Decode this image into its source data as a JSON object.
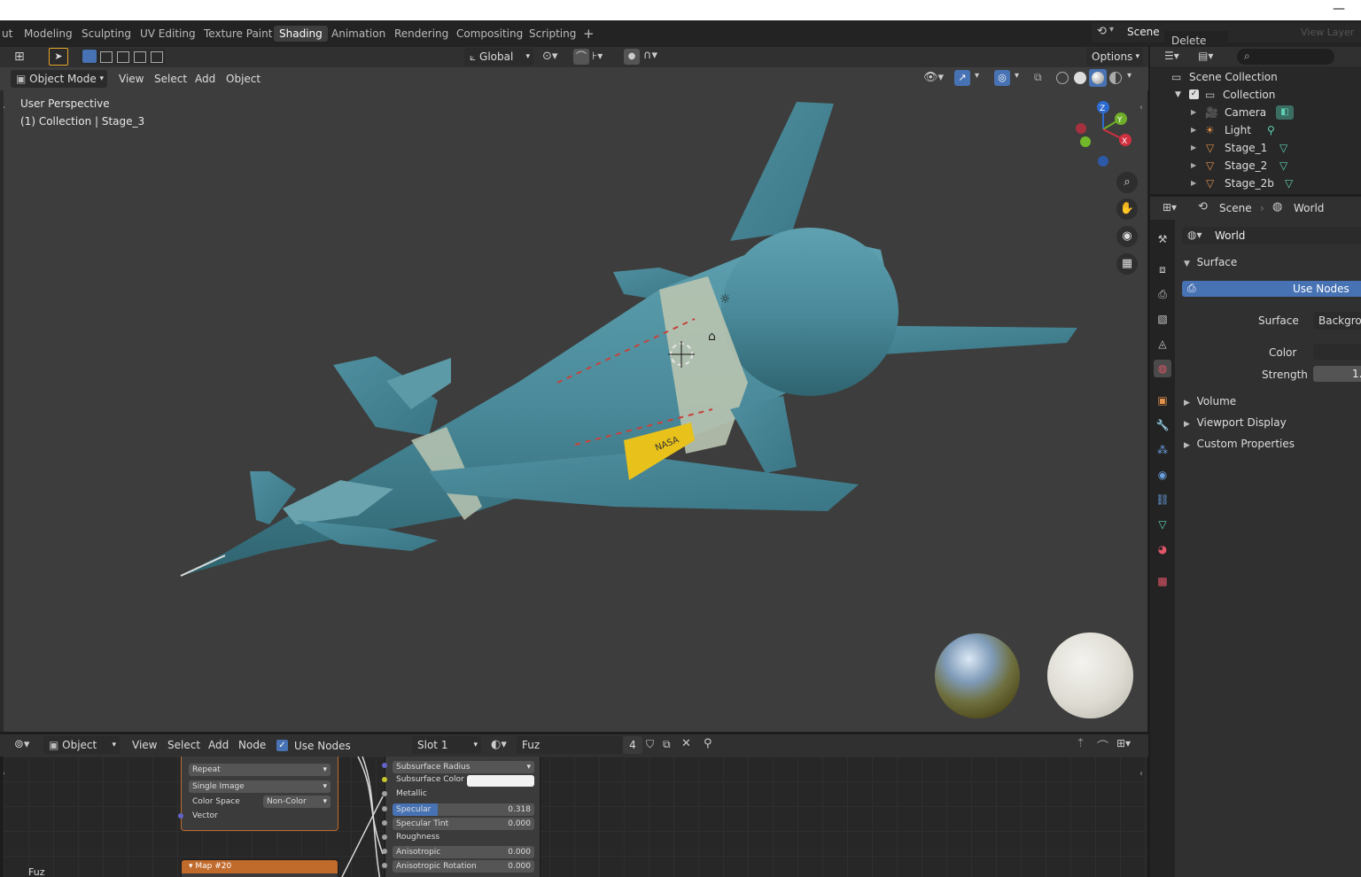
{
  "workspace_tabs": [
    "ut",
    "Modeling",
    "Sculpting",
    "UV Editing",
    "Texture Paint",
    "Shading",
    "Animation",
    "Rendering",
    "Compositing",
    "Scripting",
    "+"
  ],
  "active_tab": "Shading",
  "scene_selector": {
    "label": "Scene",
    "view_layer": "View Layer"
  },
  "delete_popup": "Delete",
  "viewport_header": {
    "transform_orientation": "Global",
    "options": "Options",
    "mode": "Object Mode",
    "menus": [
      "View",
      "Select",
      "Add",
      "Object"
    ]
  },
  "viewport": {
    "perspective": "User Perspective",
    "collection_info": "(1) Collection | Stage_3",
    "gizmo": {
      "z": "Z",
      "y": "Y",
      "x": "X"
    },
    "decal_text": "NASA"
  },
  "outliner": {
    "root": "Scene Collection",
    "collection": "Collection",
    "items": [
      "Camera",
      "Light",
      "Stage_1",
      "Stage_2",
      "Stage_2b"
    ]
  },
  "properties": {
    "scene_tab": "Scene",
    "world_tab": "World",
    "world_name": "World",
    "surface_panel": "Surface",
    "use_nodes": "Use Nodes",
    "surface_label": "Surface",
    "surface_value": "Backgrou",
    "color_label": "Color",
    "strength_label": "Strength",
    "strength_value": "1.",
    "collapsed_panels": [
      "Volume",
      "Viewport Display",
      "Custom Properties"
    ]
  },
  "node_editor": {
    "mode": "Object",
    "menus": [
      "View",
      "Select",
      "Add",
      "Node"
    ],
    "use_nodes_label": "Use Nodes",
    "slot": "Slot 1",
    "material": "Fuz",
    "users": "4",
    "footer_label": "Fuz",
    "image_node": {
      "extension": "Repeat",
      "projection": "Single Image",
      "color_space_label": "Color Space",
      "color_space_value": "Non-Color",
      "vector": "Vector"
    },
    "map_node": "Map #20",
    "bsdf": {
      "subsurface_radius": "Subsurface Radius",
      "subsurface_color": "Subsurface Color",
      "metallic": "Metallic",
      "specular_label": "Specular",
      "specular_value": "0.318",
      "specular_fraction": 0.318,
      "specular_tint_label": "Specular Tint",
      "specular_tint_value": "0.000",
      "roughness": "Roughness",
      "anisotropic_label": "Anisotropic",
      "anisotropic_value": "0.000",
      "anisotropic_rotation_label": "Anisotropic Rotation",
      "anisotropic_rotation_value": "0.000"
    }
  },
  "colors": {
    "accent": "#4772b3",
    "active_tab": "#3e3e3e",
    "model_body": "#4a8a9a",
    "model_band": "#b9c4b0",
    "decal_yellow": "#e8c21a",
    "node_orange": "#c06a2c",
    "world_icon": "#e05567"
  }
}
